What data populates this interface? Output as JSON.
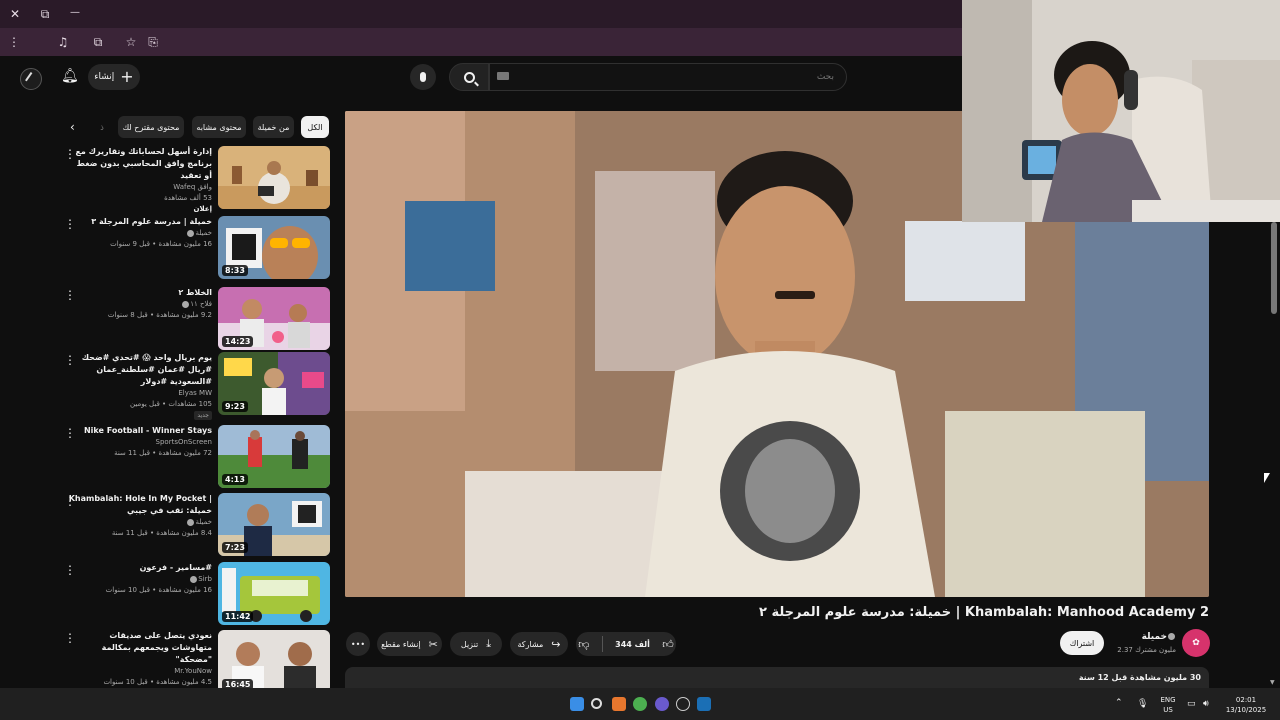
{
  "browser": {
    "window_controls": {
      "close": "✕",
      "restore": "⧉",
      "minimize": "—"
    },
    "toolbar_icons": [
      "menu-dots-icon",
      "profile-icon",
      "media-icon",
      "extensions-icon",
      "star-icon",
      "screenshot-icon"
    ]
  },
  "header": {
    "create_label": "إنشاء",
    "search_placeholder": "بحث"
  },
  "chips": [
    {
      "label": "الكل",
      "active": true
    },
    {
      "label": "من خميلة",
      "active": false
    },
    {
      "label": "محتوى مشابه",
      "active": false
    },
    {
      "label": "محتوى مقترح لك",
      "active": false
    },
    {
      "label": "ذ",
      "active": false
    }
  ],
  "recommendations": [
    {
      "title": "إدارة أسهل لحساباتك وتقاريرك مع برنامج وافق المحاسبي بدون ضغط أو تعقيد",
      "channel": "وافق Wafeq",
      "views_time": "53 ألف مشاهدة",
      "badge": "إعلان",
      "duration": "",
      "verified": false
    },
    {
      "title": "خميلة | مدرسة علوم المرجلة ٣",
      "channel": "خميلة",
      "views_time": "16 مليون مشاهدة • قبل 9 سنوات",
      "badge": "",
      "duration": "8:33",
      "verified": true
    },
    {
      "title": "الخلاط ٢",
      "channel": "فلاح ١١",
      "views_time": "9.2 مليون مشاهدة • قبل 8 سنوات",
      "badge": "",
      "duration": "14:23",
      "verified": true
    },
    {
      "title": "يوم بريال واحد 😱 #تحدي #ضحك #ريال #عمان #سلطنة_عمان #السعودية #دولار",
      "channel": "Elyas MW",
      "views_time": "105 مشاهدات • قبل يومين",
      "badge": "جديد",
      "duration": "9:23",
      "verified": false
    },
    {
      "title": "Nike Football - Winner Stays",
      "channel": "SportsOnScreen",
      "views_time": "72 مليون مشاهدة • قبل 11 سنة",
      "badge": "",
      "duration": "4:13",
      "verified": false
    },
    {
      "title": "Khambalah: Hole In My Pocket | خميلة: ثقب في جيبي",
      "channel": "خميلة",
      "views_time": "8.4 مليون مشاهدة • قبل 11 سنة",
      "badge": "",
      "duration": "7:23",
      "verified": true
    },
    {
      "title": "#مسامير - فرعون",
      "channel": "Sirb",
      "views_time": "16 مليون مشاهدة • قبل 10 سنوات",
      "badge": "",
      "duration": "11:42",
      "verified": true
    },
    {
      "title": "نعودي يتصل على صديقات متهاوشات ويجمعهم بمكالمة \"مضحكة\"",
      "channel": "Mr.YouNow",
      "views_time": "4.5 مليون مشاهدة • قبل 10 سنوات",
      "badge": "",
      "duration": "16:45",
      "verified": false
    }
  ],
  "video": {
    "title": "خميلة: مدرسة علوم المرجلة ٢ | Khambalah: Manhood Academy 2",
    "channel_name": "خميلة",
    "channel_subs": "2.37 مليون مشترك",
    "subscribe_label": "اشتراك",
    "likes": "344 ألف",
    "share_label": "مشاركة",
    "download_label": "تنزيل",
    "clip_label": "إنشاء مقطع",
    "more_label": "•••",
    "description_stats": "30 مليون مشاهدة قبل 12 سنة"
  },
  "taskbar": {
    "language": "ENG",
    "region": "US",
    "time": "02:01",
    "date": "13/10/2025"
  }
}
